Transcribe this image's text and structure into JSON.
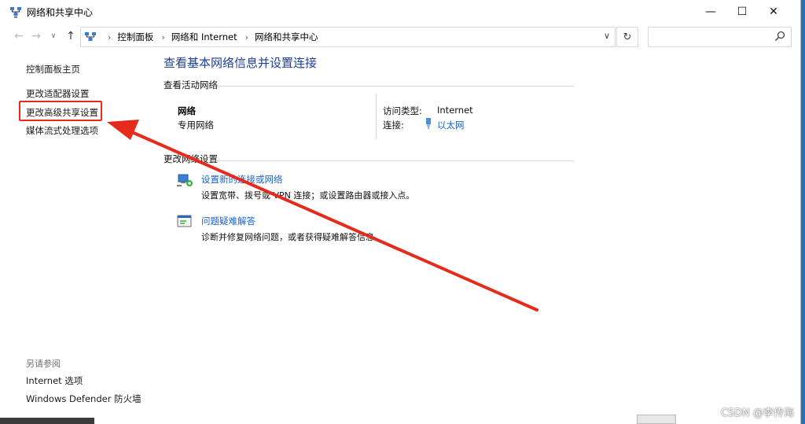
{
  "window": {
    "title": "网络和共享中心",
    "controls": {
      "minimize": "—",
      "maximize": "☐",
      "close": "✕"
    }
  },
  "addressbar": {
    "nav": {
      "back": "←",
      "forward": "→",
      "recent": "∨",
      "up": "↑"
    },
    "breadcrumbs": [
      "控制面板",
      "网络和 Internet",
      "网络和共享中心"
    ],
    "separator": "›",
    "dropdown": "∨",
    "refresh": "↻"
  },
  "search": {
    "value": "",
    "placeholder": ""
  },
  "sidebar": {
    "links": [
      "控制面板主页",
      "更改适配器设置",
      "更改高级共享设置",
      "媒体流式处理选项"
    ],
    "see_also_title": "另请参阅",
    "see_also": [
      "Internet 选项",
      "Windows Defender 防火墙"
    ]
  },
  "main": {
    "title": "查看基本网络信息并设置连接",
    "active_networks": {
      "heading": "查看活动网络",
      "name": "网络",
      "type": "专用网络",
      "access_type_label": "访问类型:",
      "access_type_value": "Internet",
      "connections_label": "连接:",
      "connection_link": "以太网"
    },
    "change_settings": {
      "heading": "更改网络设置",
      "tasks": [
        {
          "title": "设置新的连接或网络",
          "desc": "设置宽带、拨号或 VPN 连接；或设置路由器或接入点。",
          "icon": "network-setup-icon"
        },
        {
          "title": "问题疑难解答",
          "desc": "诊断并修复网络问题，或者获得疑难解答信息。",
          "icon": "troubleshoot-icon"
        }
      ]
    }
  },
  "annotation": {
    "color": "#e62a1c"
  },
  "watermark": "CSDN @李传海",
  "colors": {
    "accent_title": "#1e3f9b",
    "link": "#1b62c9",
    "annotation": "#e62a1c"
  }
}
